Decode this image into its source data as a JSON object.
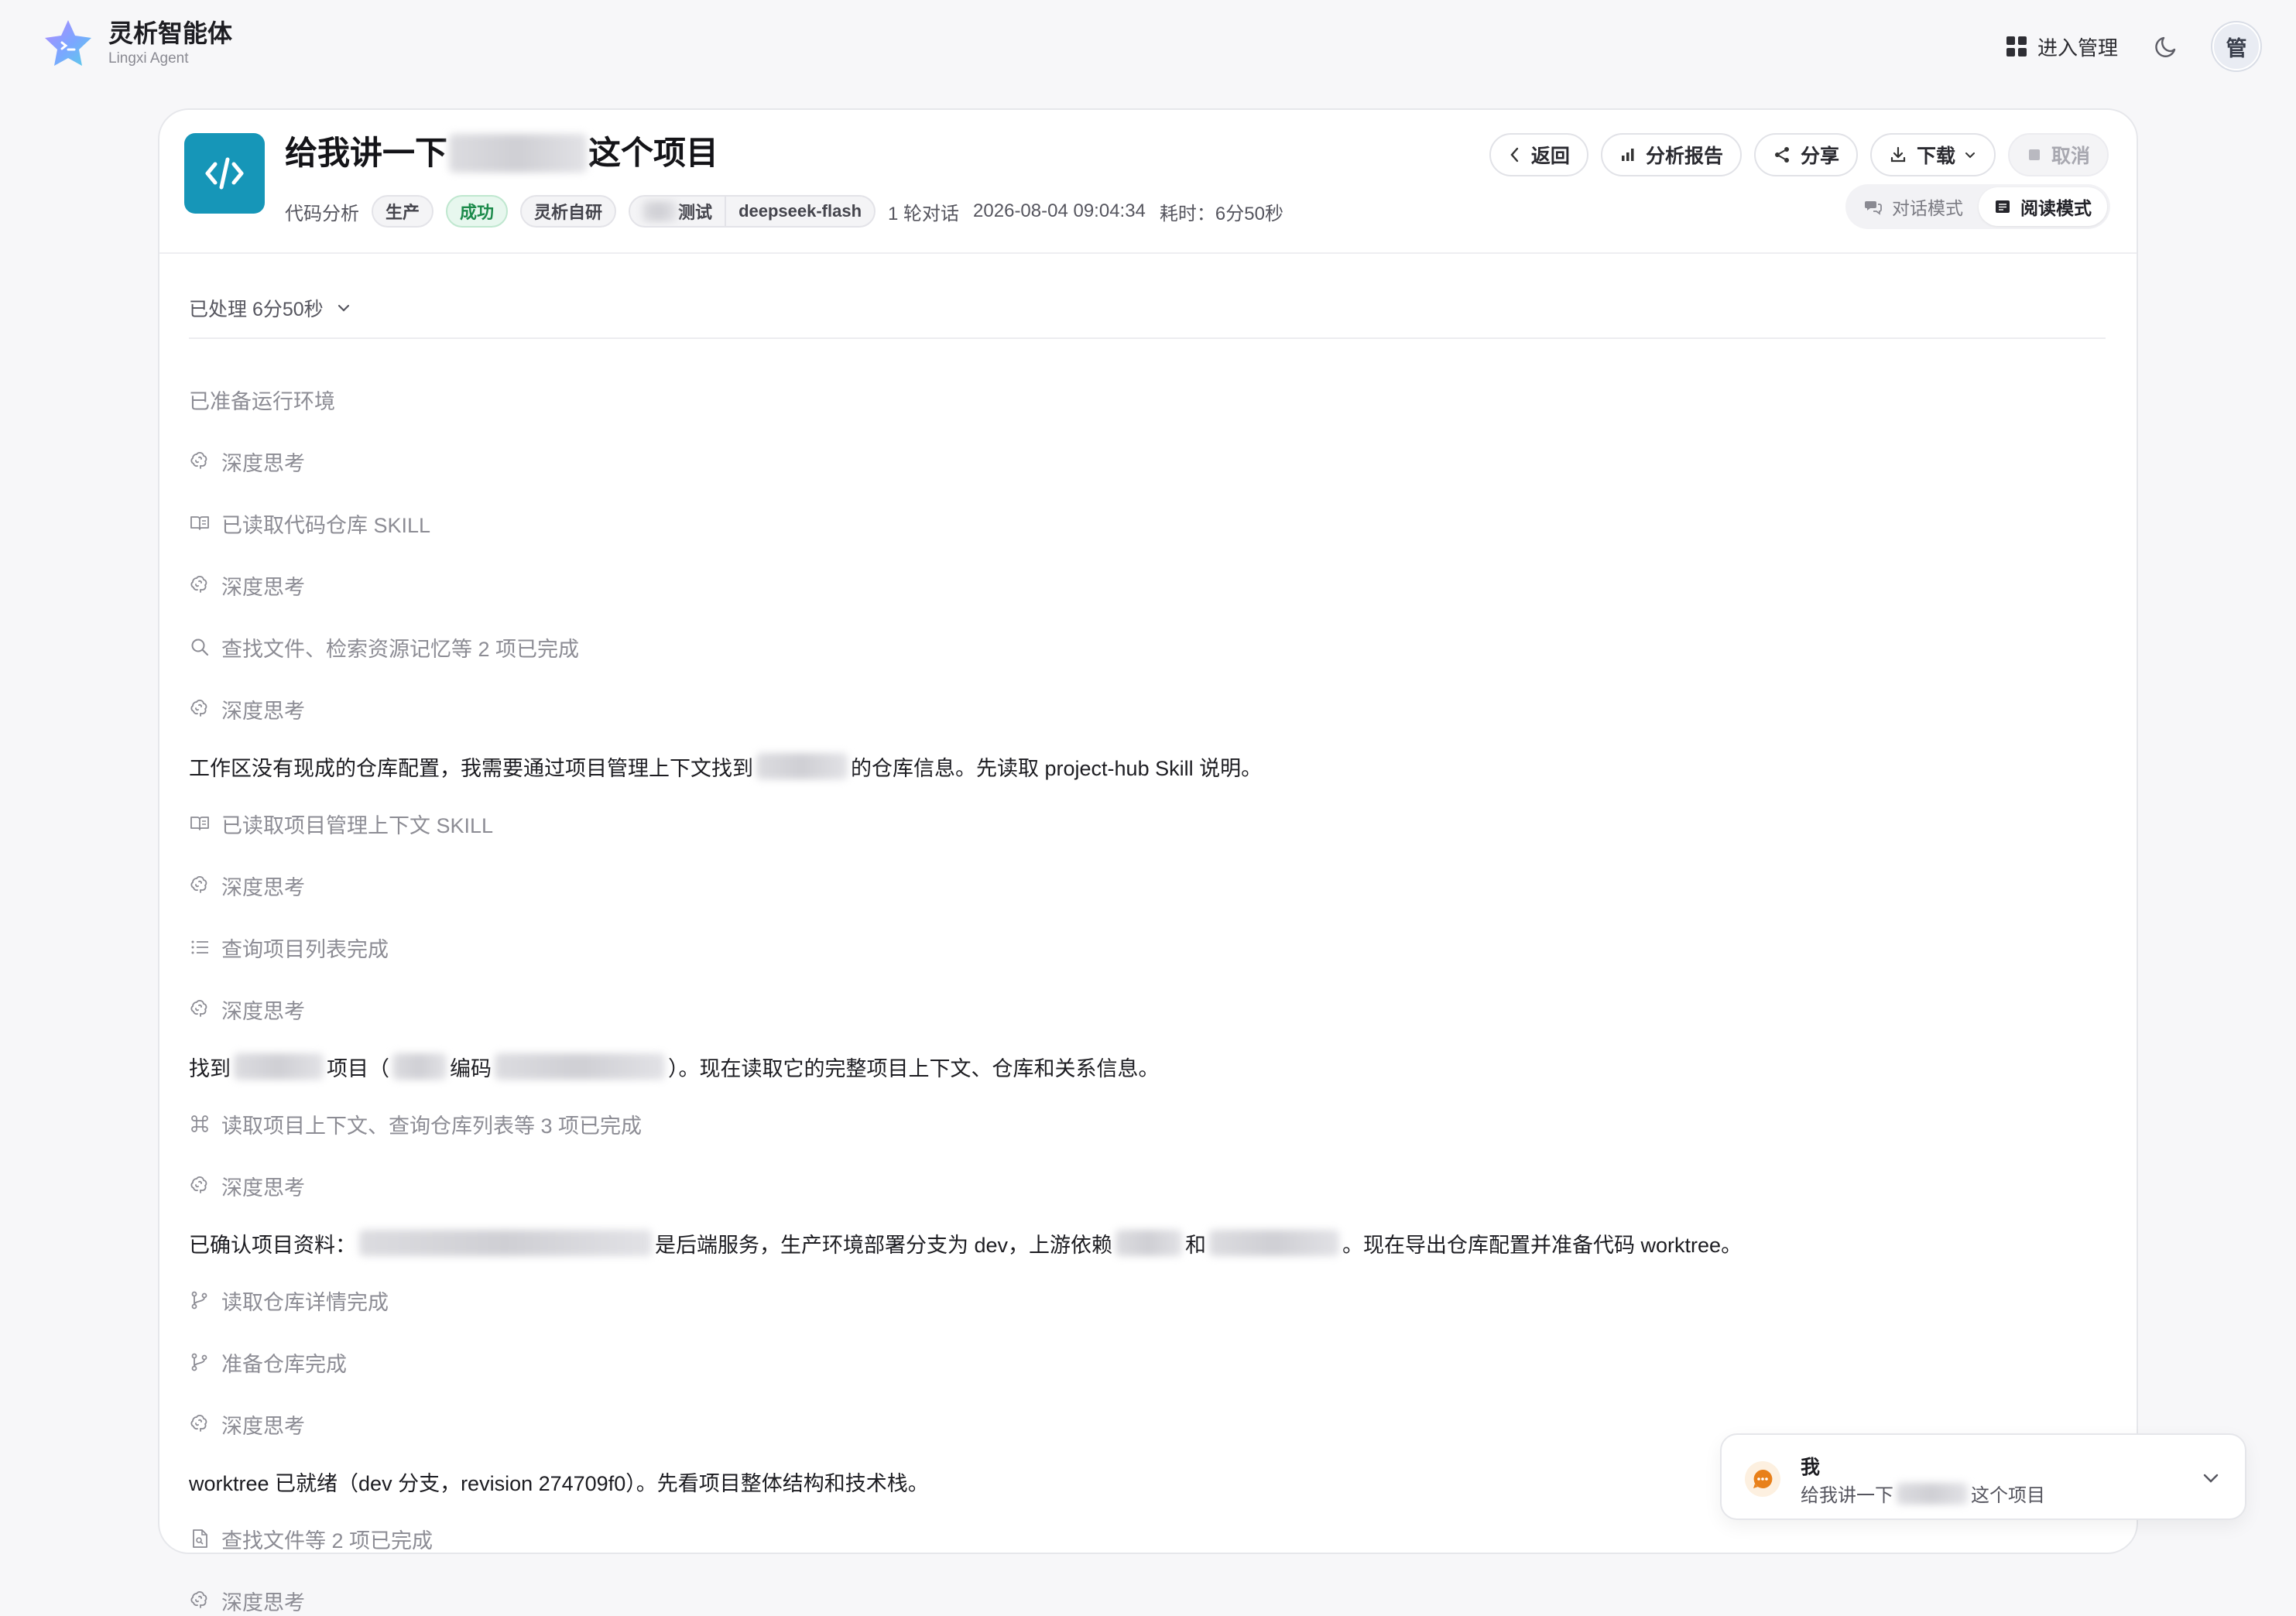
{
  "app": {
    "name": "灵析智能体",
    "subtitle": "Lingxi Agent",
    "admin_link": "进入管理",
    "avatar_text": "管"
  },
  "header": {
    "title_prefix": "给我讲一下",
    "title_suffix": "这个项目",
    "meta": {
      "category": "代码分析",
      "env_tag": "生产",
      "status_tag": "成功",
      "source_tag": "灵析自研",
      "model_left": "测试",
      "model_right": "deepseek-flash",
      "rounds": "1 轮对话",
      "timestamp": "2026-08-04 09:04:34",
      "duration": "耗时：6分50秒"
    },
    "actions": {
      "back": "返回",
      "report": "分析报告",
      "share": "分享",
      "download": "下载",
      "cancel": "取消"
    },
    "modes": {
      "chat": "对话模式",
      "read": "阅读模式",
      "active": "read"
    }
  },
  "processed_label": "已处理 6分50秒",
  "steps": [
    {
      "kind": "status",
      "icon": "none",
      "text": "已准备运行环境"
    },
    {
      "kind": "status",
      "icon": "brain-icon",
      "text": "深度思考"
    },
    {
      "kind": "status",
      "icon": "book-icon",
      "text": "已读取代码仓库 SKILL"
    },
    {
      "kind": "status",
      "icon": "brain-icon",
      "text": "深度思考"
    },
    {
      "kind": "status",
      "icon": "search-icon",
      "text": "查找文件、检索资源记忆等 2 项已完成"
    },
    {
      "kind": "status",
      "icon": "brain-icon",
      "text": "深度思考"
    },
    {
      "kind": "text",
      "parts": [
        "工作区没有现成的仓库配置，我需要通过项目管理上下文找到",
        "的仓库信息。先读取 project-hub Skill 说明。"
      ]
    },
    {
      "kind": "status",
      "icon": "book-icon",
      "text": "已读取项目管理上下文 SKILL"
    },
    {
      "kind": "status",
      "icon": "brain-icon",
      "text": "深度思考"
    },
    {
      "kind": "status",
      "icon": "list-icon",
      "text": "查询项目列表完成"
    },
    {
      "kind": "status",
      "icon": "brain-icon",
      "text": "深度思考"
    },
    {
      "kind": "text",
      "parts": [
        "找到",
        "项目（",
        "编码",
        "）。现在读取它的完整项目上下文、仓库和关系信息。"
      ]
    },
    {
      "kind": "status",
      "icon": "command-icon",
      "text": "读取项目上下文、查询仓库列表等 3 项已完成"
    },
    {
      "kind": "status",
      "icon": "brain-icon",
      "text": "深度思考"
    },
    {
      "kind": "text",
      "parts": [
        "已确认项目资料：",
        "是后端服务，生产环境部署分支为 dev，上游依赖",
        "和",
        "。现在导出仓库配置并准备代码 worktree。"
      ]
    },
    {
      "kind": "status",
      "icon": "branch-icon",
      "text": "读取仓库详情完成"
    },
    {
      "kind": "status",
      "icon": "branch-icon",
      "text": "准备仓库完成"
    },
    {
      "kind": "status",
      "icon": "brain-icon",
      "text": "深度思考"
    },
    {
      "kind": "text",
      "parts": [
        "worktree 已就绪（dev 分支，revision 274709f0）。先看项目整体结构和技术栈。"
      ]
    },
    {
      "kind": "status",
      "icon": "file-icon",
      "text": "查找文件等 2 项已完成"
    },
    {
      "kind": "status",
      "icon": "brain-icon",
      "text": "深度思考"
    }
  ],
  "chat_chip": {
    "who": "我",
    "prefix": "给我讲一下",
    "suffix": "这个项目"
  },
  "colors": {
    "accent": "#1696b8",
    "success_bg": "#e7f7ee",
    "success_text": "#1b8a4a",
    "bubble": "#e8801a"
  }
}
